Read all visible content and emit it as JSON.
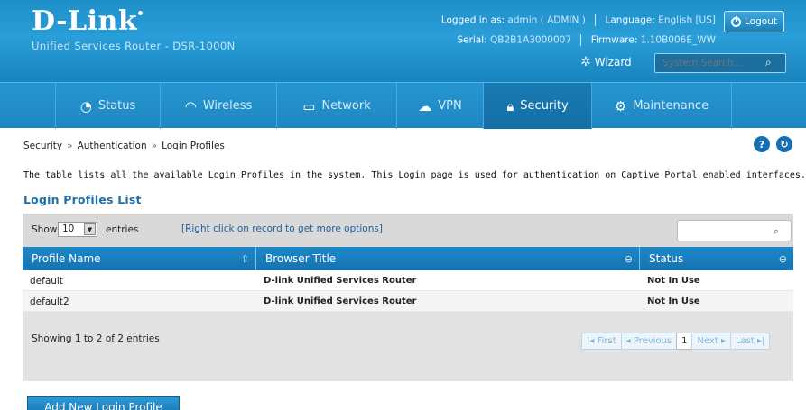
{
  "brand": {
    "logo": "D-Link",
    "subtitle": "Unified Services Router - DSR-1000N"
  },
  "session": {
    "logged_in_label": "Logged in as:",
    "logged_in_value": "admin ( ADMIN )",
    "language_label": "Language:",
    "language_value": "English [US]",
    "serial_label": "Serial:",
    "serial_value": "QB2B1A3000007",
    "firmware_label": "Firmware:",
    "firmware_value": "1.10B006E_WW",
    "logout_label": "Logout"
  },
  "wizard_label": "Wizard",
  "system_search": {
    "placeholder": "System Search..."
  },
  "nav": {
    "items": [
      {
        "label": "Status",
        "icon": "gauge-icon"
      },
      {
        "label": "Wireless",
        "icon": "wifi-icon"
      },
      {
        "label": "Network",
        "icon": "monitor-icon"
      },
      {
        "label": "VPN",
        "icon": "cloud-lock-icon"
      },
      {
        "label": "Security",
        "icon": "lock-icon"
      },
      {
        "label": "Maintenance",
        "icon": "gear-icon"
      }
    ],
    "active": "Security"
  },
  "breadcrumb": {
    "level1": "Security",
    "level2": "Authentication",
    "level3": "Login Profiles",
    "separator": "»"
  },
  "description": "The table lists all the available Login Profiles in the system. This Login page is used for authentication on Captive Portal enabled interfaces.",
  "list_title": "Login Profiles List",
  "table": {
    "show_label": "Show",
    "show_value": "10",
    "entries_label": "entries",
    "hint": "[Right click on record to get more options]",
    "columns": [
      "Profile Name",
      "Browser Title",
      "Status"
    ],
    "rows": [
      {
        "profile": "default",
        "title": "D-link Unified Services Router",
        "status": "Not In Use"
      },
      {
        "profile": "default2",
        "title": "D-link Unified Services Router",
        "status": "Not In Use"
      }
    ],
    "info": "Showing 1 to 2 of 2 entries",
    "pager": {
      "first": "First",
      "previous": "Previous",
      "page": "1",
      "next": "Next",
      "last": "Last"
    }
  },
  "add_button": "Add New Login Profile"
}
